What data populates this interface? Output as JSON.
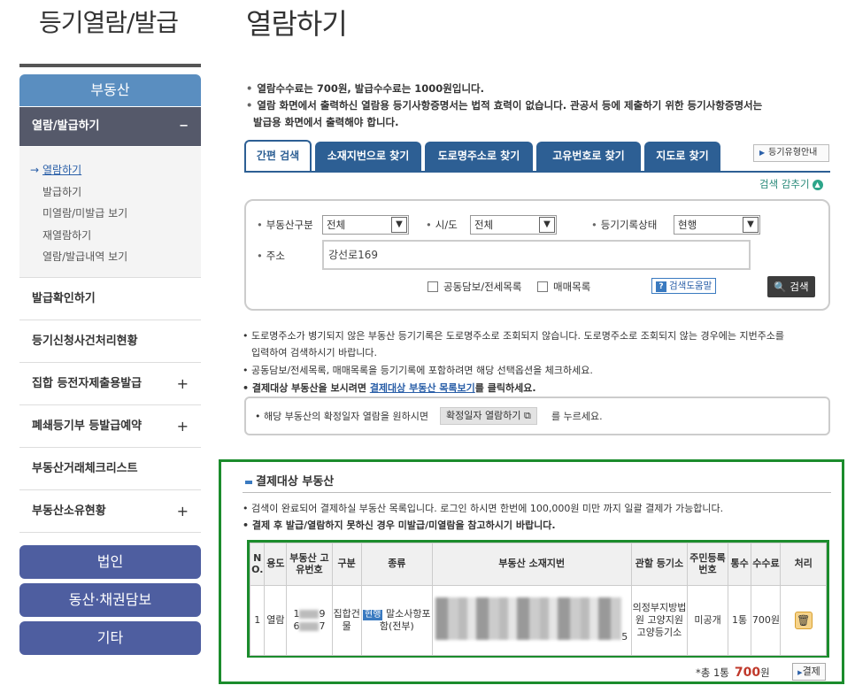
{
  "left": {
    "title": "등기열람/발급",
    "realestate": "부동산",
    "active_menu": "열람/발급하기",
    "active_toggle": "−",
    "sub_items": [
      "열람하기",
      "발급하기",
      "미열람/미발급 보기",
      "재열람하기",
      "열람/발급내역 보기"
    ],
    "active_arrow": "→",
    "menus": [
      {
        "label": "발급확인하기",
        "toggle": ""
      },
      {
        "label": "등기신청사건처리현황",
        "toggle": ""
      },
      {
        "label": "집합 등전자제출용발급",
        "toggle": "+"
      },
      {
        "label": "폐쇄등기부 등발급예약",
        "toggle": "+"
      },
      {
        "label": "부동산거래체크리스트",
        "toggle": ""
      },
      {
        "label": "부동산소유현황",
        "toggle": "+"
      }
    ],
    "buttons": [
      "법인",
      "동산·채권담보",
      "기타"
    ]
  },
  "main": {
    "title": "열람하기",
    "notices": [
      "열람수수료는 700원, 발급수수료는 1000원입니다.",
      "열람 화면에서 출력하신 열람용 등기사항증명서는 법적 효력이 없습니다. 관공서 등에 제출하기 위한 등기사항증명서는",
      "발급용 화면에서 출력해야 합니다."
    ],
    "tabs": [
      "간편 검색",
      "소재지번으로 찾기",
      "도로명주소로 찾기",
      "고유번호로 찾기",
      "지도로 찾기"
    ],
    "guide_button": "등기유형안내",
    "collapse": "검색 감추기",
    "search": {
      "type_label": "부동산구분",
      "type_value": "전체",
      "region_label": "시/도",
      "region_value": "전체",
      "status_label": "등기기록상태",
      "status_value": "현행",
      "address_label": "주소",
      "address_value": "강선로169",
      "check1": "공동담보/전세목록",
      "check2": "매매목록",
      "help": "검색도움말",
      "button": "검색"
    },
    "notes": [
      "도로명주소가 병기되지 않은 부동산 등기기록은 도로명주소로 조회되지 않습니다. 도로명주소로 조회되지 않는 경우에는 지번주소를",
      "입력하여 검색하시기 바랍니다.",
      "공동담보/전세목록, 매매목록을 등기기록에 포함하려면 해당 선택옵션을 체크하세요."
    ],
    "note_bold_prefix": "결제대상 부동산을 보시려면 ",
    "note_link": "결제대상 부동산 목록보기",
    "note_bold_suffix": "를 클릭하세요.",
    "confirm_prefix": "해당 부동산의 확정일자 열람을 원하시면",
    "confirm_button": "확정일자 열람하기",
    "confirm_suffix": "를 누르세요."
  },
  "payment": {
    "title": "결제대상 부동산",
    "line1": "검색이 완료되어 결제하실 부동산 목록입니다. 로그인 하시면 한번에 100,000원 미만 까지 일괄 결제가 가능합니다.",
    "line2": "결제 후 발급/열람하지 못하신 경우 미발급/미열람을 참고하시기 바랍니다.",
    "headers": [
      "N O.",
      "용도",
      "부동산 고유번호",
      "구분",
      "종류",
      "부동산 소재지번",
      "관할 등기소",
      "주민등록번호",
      "통수",
      "수수료",
      "처리"
    ],
    "row": {
      "no": "1",
      "use": "열람",
      "id_a": "1",
      "id_b": "9",
      "id_c": "6",
      "id_d": "7",
      "category": "집합건물",
      "kind_badge": "현행",
      "kind_text": "말소사항포함(전부)",
      "addr_tail": "5",
      "office": "의정부지방법원 고양지원 고양등기소",
      "resident": "미공개",
      "count": "1통",
      "fee": "700원"
    },
    "total_label": "*총 1통",
    "total_amount": "700",
    "total_unit": "원",
    "pay_button": "결제"
  }
}
